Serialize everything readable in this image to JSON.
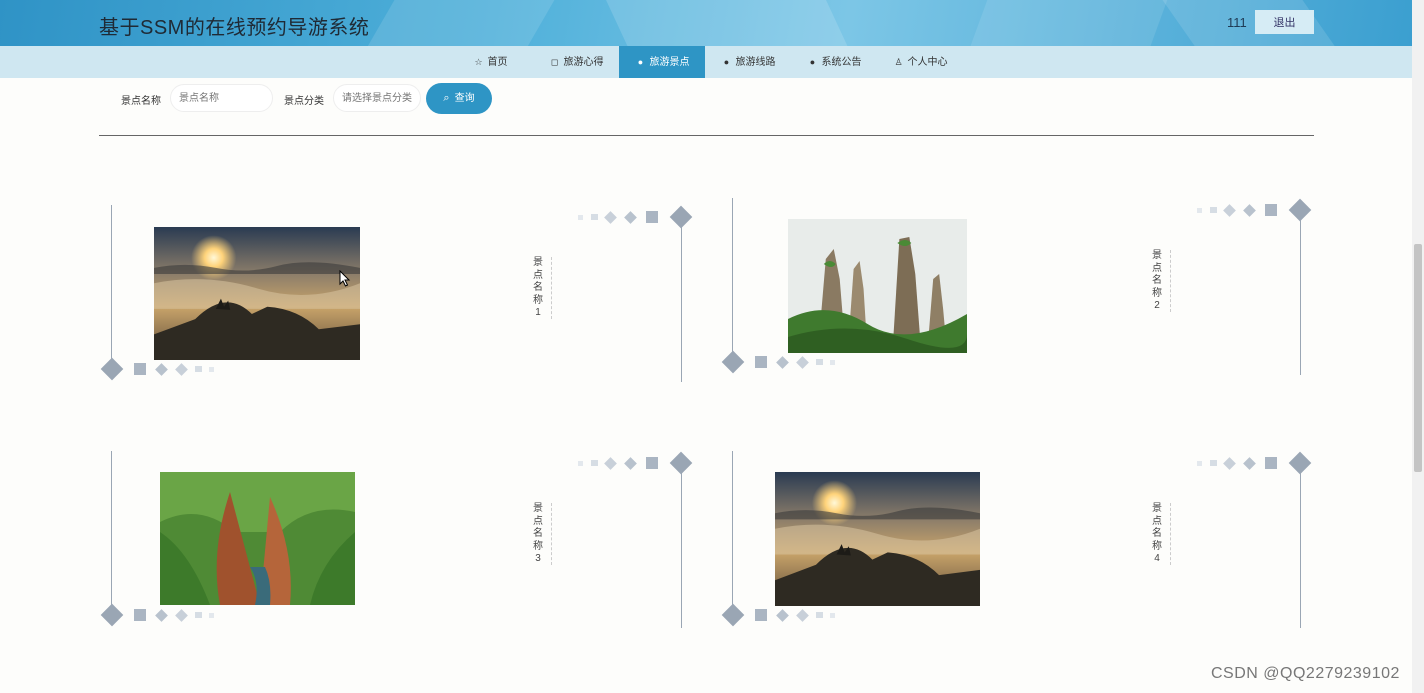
{
  "header": {
    "title": "基于SSM的在线预约导游系统",
    "username": "111",
    "logout_label": "退出"
  },
  "nav": {
    "items": [
      {
        "label": "首页",
        "icon": "star-icon"
      },
      {
        "label": "旅游心得",
        "icon": "bag-icon"
      },
      {
        "label": "旅游景点",
        "icon": "info-icon",
        "active": true
      },
      {
        "label": "旅游线路",
        "icon": "question-icon"
      },
      {
        "label": "系统公告",
        "icon": "info-icon"
      },
      {
        "label": "个人中心",
        "icon": "user-icon"
      }
    ]
  },
  "search": {
    "name_label": "景点名称",
    "name_placeholder": "景点名称",
    "category_label": "景点分类",
    "category_placeholder": "请选择景点分类",
    "button_label": "查询"
  },
  "spots": [
    {
      "name": "景点名称1",
      "image": "sunrise-sea-of-clouds"
    },
    {
      "name": "景点名称2",
      "image": "karst-stone-pillars"
    },
    {
      "name": "景点名称3",
      "image": "green-canyon-river"
    },
    {
      "name": "景点名称4",
      "image": "sunrise-sea-of-clouds"
    }
  ],
  "watermark": "CSDN @QQ2279239102",
  "colors": {
    "accent": "#2e95c5",
    "nav_bg": "#cfe7f1",
    "decor": "#9aa6b4"
  }
}
